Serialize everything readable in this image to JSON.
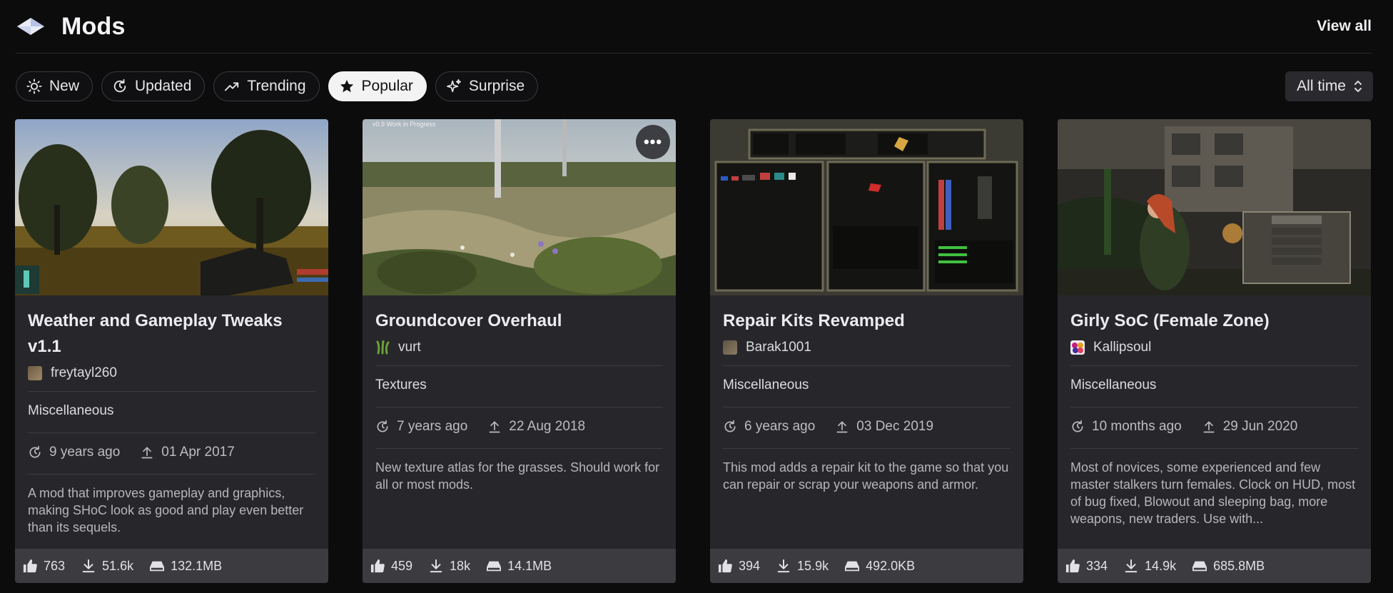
{
  "header": {
    "title": "Mods",
    "view_all": "View all",
    "logo_icon": "diamond-logo-icon"
  },
  "filters": {
    "items": [
      {
        "label": "New",
        "icon": "sun-icon",
        "active": false
      },
      {
        "label": "Updated",
        "icon": "refresh-icon",
        "active": false
      },
      {
        "label": "Trending",
        "icon": "trending-up-icon",
        "active": false
      },
      {
        "label": "Popular",
        "icon": "star-icon",
        "active": true
      },
      {
        "label": "Surprise",
        "icon": "sparkles-icon",
        "active": false
      }
    ],
    "sort": {
      "label": "All time",
      "icon": "chevron-updown-icon"
    }
  },
  "colors": {
    "background": "#0c0c0d",
    "card": "#27272b",
    "card_footer": "#3b3b40",
    "active_filter": "#f3f3f4"
  },
  "cards": [
    {
      "title": "Weather and Gameplay Tweaks v1.1",
      "author": "freytayl260",
      "category": "Miscellaneous",
      "updated": "9 years ago",
      "uploaded": "01 Apr 2017",
      "description": "A mod that improves gameplay and graphics, making SHoC look as good and play even better than its sequels.",
      "likes": "763",
      "downloads": "51.6k",
      "size": "132.1MB"
    },
    {
      "title": "Groundcover Overhaul",
      "author": "vurt",
      "category": "Textures",
      "updated": "7 years ago",
      "uploaded": "22 Aug 2018",
      "description": "New texture atlas for the grasses. Should work for all or most mods.",
      "likes": "459",
      "downloads": "18k",
      "size": "14.1MB",
      "thumb_caption": "v0.9 Work in Progress"
    },
    {
      "title": "Repair Kits Revamped",
      "author": "Barak1001",
      "category": "Miscellaneous",
      "updated": "6 years ago",
      "uploaded": "03 Dec 2019",
      "description": "This mod adds a repair kit to the game so that you can repair or scrap your weapons and armor.",
      "likes": "394",
      "downloads": "15.9k",
      "size": "492.0KB"
    },
    {
      "title": "Girly SoC (Female Zone)",
      "author": "Kallipsoul",
      "category": "Miscellaneous",
      "updated": "10 months ago",
      "uploaded": "29 Jun 2020",
      "description": "Most of novices, some experienced and few master stalkers turn females. Clock on HUD, most of bug fixed, Blowout and sleeping bag, more weapons, new traders. Use with...",
      "likes": "334",
      "downloads": "14.9k",
      "size": "685.8MB"
    }
  ]
}
